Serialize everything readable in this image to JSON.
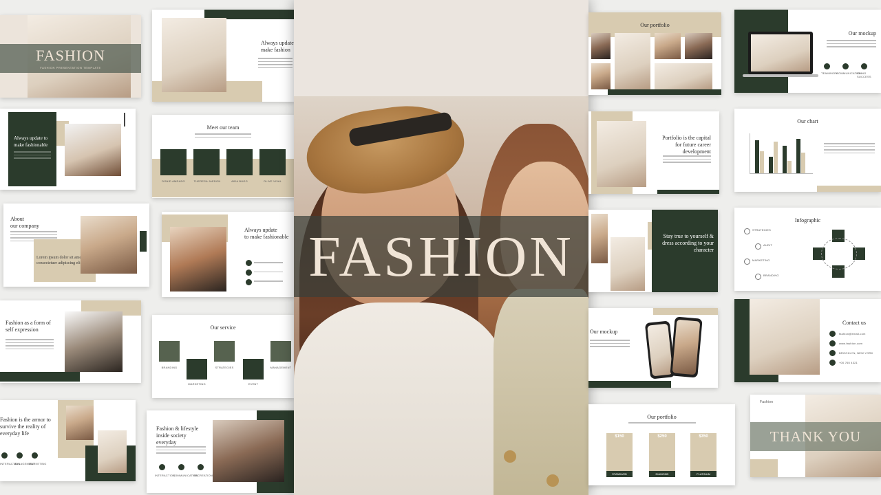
{
  "hero": {
    "title": "FASHION"
  },
  "thumb_cover": {
    "title": "FASHION",
    "subtitle": "FASHION PRESENTATION TEMPLATE"
  },
  "slides": {
    "always_update_a": "Always update to make fashionable",
    "always_update_b": "Always update\nmake fashion",
    "about": "About\nour company",
    "about_quote": "Lorem ipsum dolor sit amet, consectetuer adipiscing elit",
    "expression": "Fashion as a form of self expression",
    "armor": "Fashion is the armor to survive the reality of everyday life",
    "team_title": "Meet our team",
    "team_members": [
      "DONID AMRADO",
      "THERESA JAEDON",
      "AIDA BUGG",
      "OLIVE VIVAL"
    ],
    "always_update_c": "Always update\nto make fashionable",
    "service_title": "Our service",
    "services": [
      "BRANDING",
      "MARKETING",
      "STRATEGIES",
      "EVENT",
      "MANAGEMENT"
    ],
    "lifestyle": "Fashion & lifestyle inside society everyday",
    "lifestyle_icons": [
      "INTERACTION",
      "COMMUNICATION",
      "RECREATION"
    ],
    "armor_icons": [
      "INTERACTION",
      "MANAGEMENT",
      "MARKETING"
    ],
    "portfolio_title": "Our portfolio",
    "portfolio_capital": "Portfolio is the capital for future career development",
    "stay_true": "Stay true to yourself & dress according to your character",
    "mockup_title": "Our mockup",
    "mockup_phone_title": "Our mockup",
    "mockup_icons": [
      "TEAMWORK",
      "COMMUNICATION",
      "BEING SUCCESS"
    ],
    "chart_title": "Our chart",
    "infographic_title": "Infographic",
    "infographic_items": [
      "STRATEGIES",
      "AUDIT",
      "MARKETING",
      "BRANDING"
    ],
    "contact_title": "Contact us",
    "contact_items": [
      "fashion@email.com",
      "www.fashion.com",
      "BROOKLYN, NEW YORK",
      "+00 765 4321"
    ],
    "portfolio_plans_title": "Our portfolio",
    "plans": [
      {
        "price": "$150",
        "name": "STANDARD"
      },
      {
        "price": "$250",
        "name": "DIAMOND"
      },
      {
        "price": "$350",
        "name": "PLATINUM"
      }
    ],
    "thank_label": "Fashion",
    "thank_you": "THANK YOU"
  },
  "colors": {
    "green": "#2b3b2c",
    "beige": "#d8cbb0",
    "cream": "#f0e4d6"
  }
}
